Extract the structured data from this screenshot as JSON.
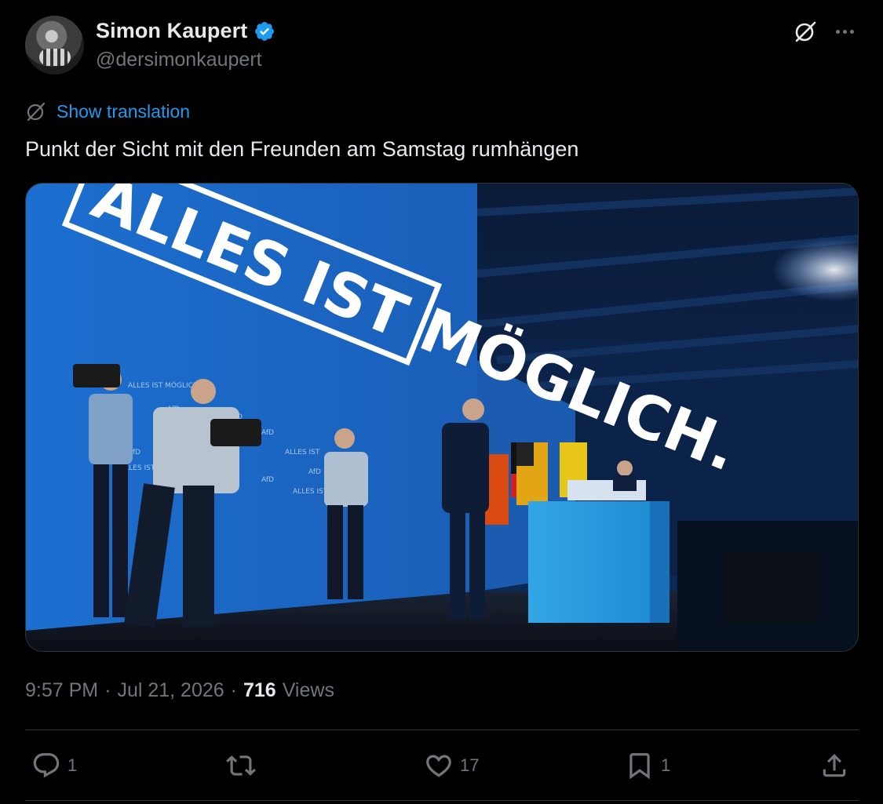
{
  "author": {
    "display_name": "Simon Kaupert",
    "handle": "@dersimonkaupert",
    "verified": true
  },
  "translation": {
    "label": "Show translation"
  },
  "tweet": {
    "text": "Punkt der Sicht mit den Freunden am Samstag rumhängen"
  },
  "media": {
    "banner_text_line1": "ALLES IST MÖGLICH.",
    "podium_sign": "ALLES IST MÖGLICH"
  },
  "meta": {
    "time": "9:57 PM",
    "separator": "·",
    "date": "Jul 21, 2026",
    "views_count": "716",
    "views_label": "Views"
  },
  "actions": {
    "replies": "1",
    "retweets": "",
    "likes": "17",
    "bookmarks": "1"
  },
  "colors": {
    "background": "#000000",
    "text": "#e7e9ea",
    "secondary": "#71767b",
    "accent": "#1d9bf0",
    "divider": "#2f3336"
  },
  "icons": [
    "verified-badge-icon",
    "grok-icon",
    "more-icon",
    "translate-icon",
    "reply-icon",
    "retweet-icon",
    "like-icon",
    "bookmark-icon",
    "share-icon"
  ]
}
